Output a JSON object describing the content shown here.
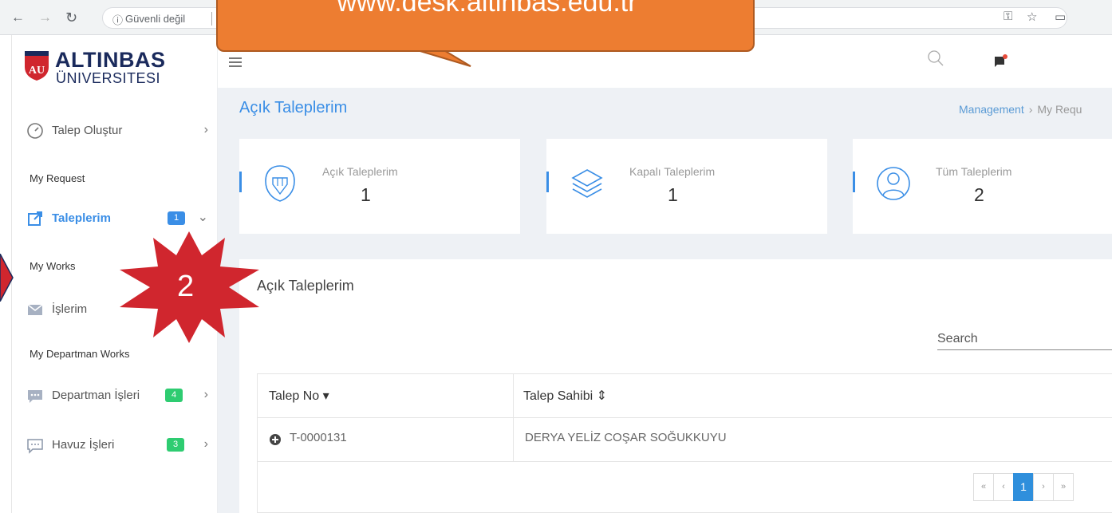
{
  "browser": {
    "security_label": "Güvenli değil",
    "back_icon": "arrow-left-icon",
    "forward_icon": "arrow-right-icon",
    "reload_icon": "reload-icon"
  },
  "callout": {
    "text": "www.desk.altinbas.edu.tr"
  },
  "logo": {
    "line1": "ALTINBAS",
    "line2": "ÜNIVERSITESI",
    "mark": "AU"
  },
  "sidebar": {
    "create": {
      "label": "Talep Oluştur",
      "icon": "gauge-icon"
    },
    "section_my_request": "My Request",
    "taleplerim": {
      "label": "Taleplerim",
      "badge": "1",
      "icon": "external-link-icon"
    },
    "section_my_works": "My Works",
    "islerim": {
      "label": "İşlerim",
      "icon": "envelope-icon"
    },
    "section_dept": "My Departman Works",
    "departman": {
      "label": "Departman İşleri",
      "badge": "4",
      "icon": "chat-icon"
    },
    "havuz": {
      "label": "Havuz İşleri",
      "badge": "3",
      "icon": "comment-icon"
    }
  },
  "annotation": {
    "number": "2"
  },
  "page": {
    "title": "Açık Taleplerim"
  },
  "breadcrumb": {
    "root": "Management",
    "current": "My Requ"
  },
  "stats": [
    {
      "label": "Açık Taleplerim",
      "value": "1",
      "icon": "shield-pencil-icon"
    },
    {
      "label": "Kapalı Taleplerim",
      "value": "1",
      "icon": "layers-icon"
    },
    {
      "label": "Tüm Taleplerim",
      "value": "2",
      "icon": "user-icon"
    }
  ],
  "panel": {
    "title": "Açık Taleplerim",
    "search_placeholder": "Search"
  },
  "table": {
    "columns": [
      "Talep No ▾",
      "Talep Sahibi ⇕"
    ],
    "rows": [
      {
        "no": "T-0000131",
        "owner": "DERYA YELİZ COŞAR SOĞUKKUYU"
      }
    ]
  },
  "pager": {
    "first": "«",
    "prev": "‹",
    "current": "1",
    "next": "›",
    "last": "»"
  },
  "colors": {
    "accent": "#3a8ee6",
    "badge_blue": "#3a8ee6",
    "badge_green": "#2ecc71",
    "callout": "#ed7d31",
    "star": "#d0262e"
  }
}
